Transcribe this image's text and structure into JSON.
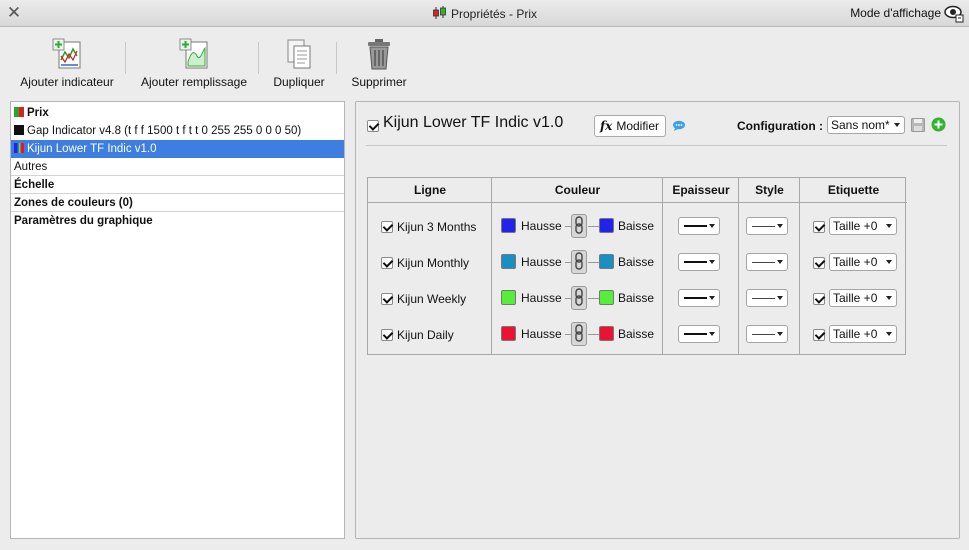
{
  "window": {
    "title": "Propriétés - Prix",
    "view_mode": "Mode d'affichage"
  },
  "toolbar": {
    "add_indicator": "Ajouter indicateur",
    "add_fill": "Ajouter remplissage",
    "duplicate": "Dupliquer",
    "delete": "Supprimer"
  },
  "tree": {
    "items": [
      {
        "label": "Prix"
      },
      {
        "label": "Gap Indicator v4.8 (t f f 1500 t f t t 0 255 255 0 0 0 50)"
      },
      {
        "label": "Kijun Lower TF Indic  v1.0"
      },
      {
        "label": "Autres"
      },
      {
        "label": "Échelle"
      },
      {
        "label": "Zones de couleurs (0)"
      },
      {
        "label": "Paramètres du graphique"
      }
    ]
  },
  "indicator": {
    "title": "Kijun Lower TF Indic  v1.0",
    "modify_label": "Modifier",
    "fx_symbol": "fx",
    "config_label": "Configuration :",
    "config_value": "Sans nom*"
  },
  "table": {
    "headers": {
      "line": "Ligne",
      "color": "Couleur",
      "thickness": "Epaisseur",
      "style": "Style",
      "label": "Etiquette"
    },
    "rows": [
      {
        "name": "Kijun 3 Months",
        "up_label": "Hausse",
        "down_label": "Baisse",
        "up_color": "#2222ee",
        "down_color": "#2222ee",
        "label_value": "Taille +0"
      },
      {
        "name": "Kijun Monthly",
        "up_label": "Hausse",
        "down_label": "Baisse",
        "up_color": "#1a8fc4",
        "down_color": "#1a8fc4",
        "label_value": "Taille +0"
      },
      {
        "name": "Kijun Weekly",
        "up_label": "Hausse",
        "down_label": "Baisse",
        "up_color": "#55ee3a",
        "down_color": "#55ee3a",
        "label_value": "Taille +0"
      },
      {
        "name": "Kijun Daily",
        "up_label": "Hausse",
        "down_label": "Baisse",
        "up_color": "#ee1133",
        "down_color": "#ee1133",
        "label_value": "Taille +0"
      }
    ]
  },
  "colors": {
    "selection": "#3d7ee0"
  }
}
